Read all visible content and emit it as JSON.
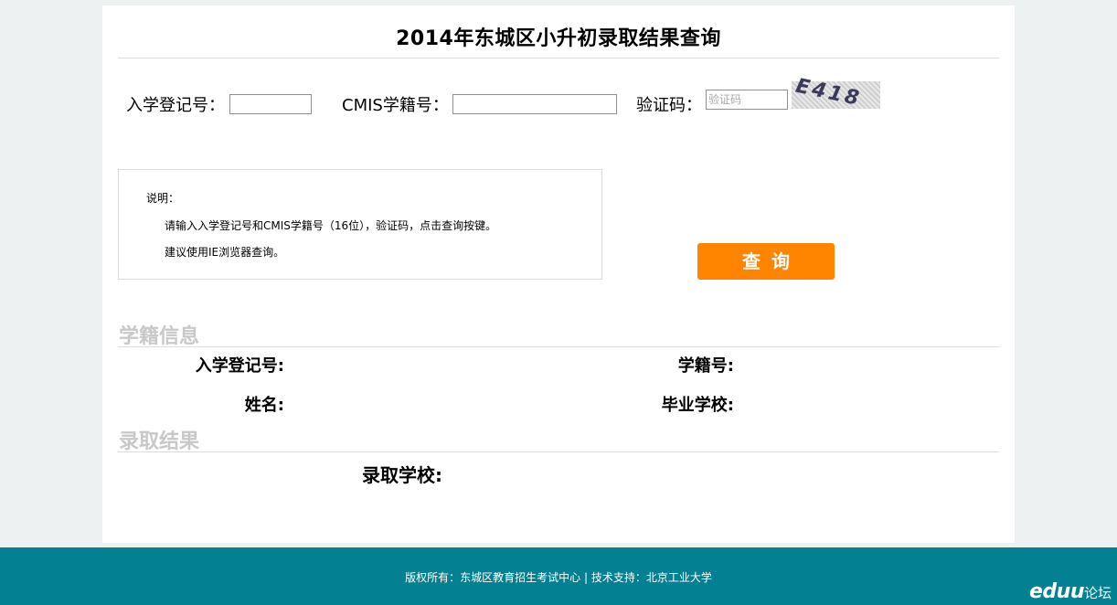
{
  "page_title": "2014年东城区小升初录取结果查询",
  "form": {
    "reg_label": "入学登记号：",
    "cmis_label": "CMIS学籍号：",
    "captcha_label": "验证码：",
    "captcha_placeholder": "验证码",
    "captcha_image_text": "E418"
  },
  "note": {
    "heading": "说明：",
    "lines": [
      "请输入入学登记号和CMIS学籍号（16位），验证码，点击查询按键。",
      "建议使用IE浏览器查询。"
    ]
  },
  "query_button": "查询",
  "student_info": {
    "title": "学籍信息",
    "reg_no": "入学登记号:",
    "student_no": "学籍号:",
    "name": "姓名:",
    "grad_school": "毕业学校:"
  },
  "admission": {
    "title": "录取结果",
    "school": "录取学校:"
  },
  "footer": {
    "text": "版权所有：东城区教育招生考试中心 | 技术支持：北京工业大学",
    "logo_main": "eduu",
    "logo_sub": "论坛"
  },
  "colors": {
    "accent": "#ff8400",
    "footer_bg": "#038092",
    "section_title": "#c8c8c8"
  }
}
